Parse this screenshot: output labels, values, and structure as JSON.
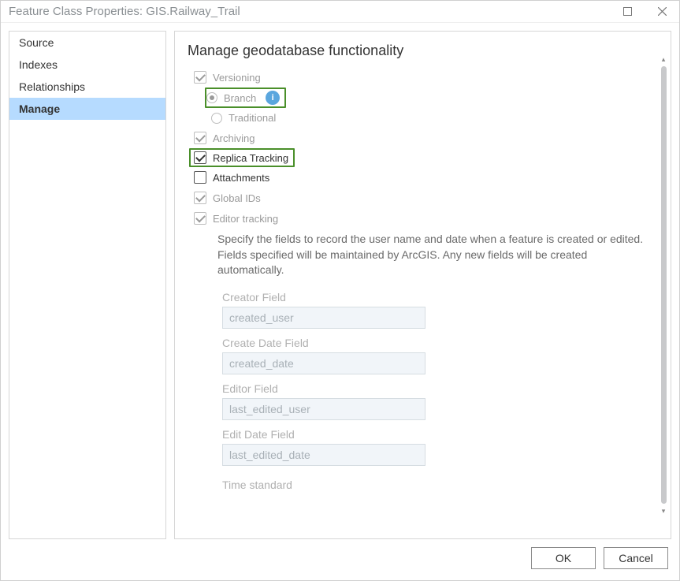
{
  "window": {
    "title": "Feature Class Properties: GIS.Railway_Trail"
  },
  "sidebar": {
    "items": [
      {
        "label": "Source",
        "selected": false
      },
      {
        "label": "Indexes",
        "selected": false
      },
      {
        "label": "Relationships",
        "selected": false
      },
      {
        "label": "Manage",
        "selected": true
      }
    ]
  },
  "content": {
    "heading": "Manage geodatabase functionality",
    "versioning": {
      "label": "Versioning",
      "checked": true,
      "enabled": false
    },
    "branch": {
      "label": "Branch",
      "checked": true,
      "enabled": false,
      "highlight": true
    },
    "traditional": {
      "label": "Traditional",
      "checked": false,
      "enabled": false
    },
    "archiving": {
      "label": "Archiving",
      "checked": true,
      "enabled": false
    },
    "replica_tracking": {
      "label": "Replica Tracking",
      "checked": true,
      "enabled": true,
      "highlight": true
    },
    "attachments": {
      "label": "Attachments",
      "checked": false,
      "enabled": true
    },
    "global_ids": {
      "label": "Global IDs",
      "checked": true,
      "enabled": false
    },
    "editor_tracking": {
      "label": "Editor tracking",
      "checked": true,
      "enabled": false,
      "description": "Specify the fields to record the user name and date when a feature is created or edited. Fields specified will be maintained by ArcGIS. Any new fields will be created automatically.",
      "fields": {
        "creator_field": {
          "label": "Creator Field",
          "value": "created_user"
        },
        "create_date_field": {
          "label": "Create Date Field",
          "value": "created_date"
        },
        "editor_field": {
          "label": "Editor Field",
          "value": "last_edited_user"
        },
        "edit_date_field": {
          "label": "Edit Date Field",
          "value": "last_edited_date"
        }
      },
      "time_standard_label": "Time standard"
    }
  },
  "footer": {
    "ok": "OK",
    "cancel": "Cancel"
  }
}
